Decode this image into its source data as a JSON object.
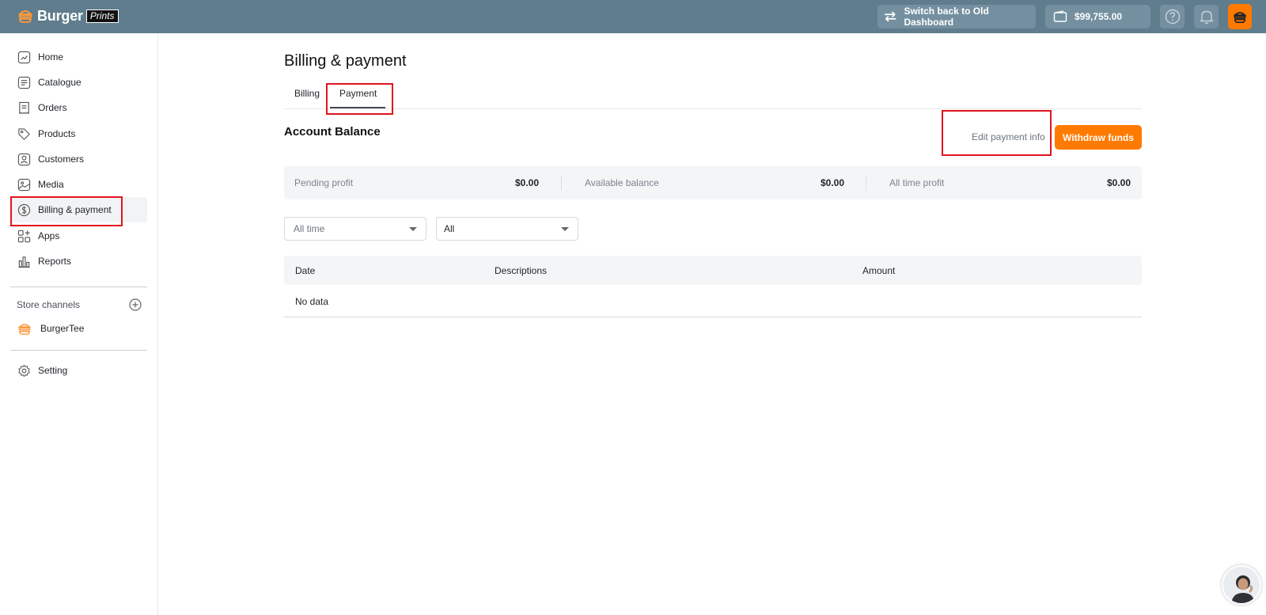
{
  "header": {
    "brand": "Burger",
    "brand_sub": "Prints",
    "switch_label": "Switch back to Old Dashboard",
    "balance": "$99,755.00",
    "accent_color": "#ff7a00",
    "bar_color": "#5f7d8c"
  },
  "sidebar": {
    "items": [
      {
        "label": "Home",
        "icon": "home-chart-icon"
      },
      {
        "label": "Catalogue",
        "icon": "catalogue-icon"
      },
      {
        "label": "Orders",
        "icon": "orders-icon"
      },
      {
        "label": "Products",
        "icon": "tag-icon"
      },
      {
        "label": "Customers",
        "icon": "customer-icon"
      },
      {
        "label": "Media",
        "icon": "image-icon"
      },
      {
        "label": "Billing & payment",
        "icon": "dollar-circle-icon"
      },
      {
        "label": "Apps",
        "icon": "apps-grid-icon"
      },
      {
        "label": "Reports",
        "icon": "bar-chart-icon"
      }
    ],
    "store_channels_label": "Store channels",
    "channel_name": "BurgerTee",
    "setting_label": "Setting"
  },
  "main": {
    "title": "Billing & payment",
    "tabs": [
      {
        "label": "Billing"
      },
      {
        "label": "Payment"
      }
    ],
    "account_balance_title": "Account Balance",
    "edit_payment_label": "Edit payment info",
    "withdraw_label": "Withdraw funds",
    "stats": [
      {
        "label": "Pending profit",
        "value": "$0.00"
      },
      {
        "label": "Available balance",
        "value": "$0.00"
      },
      {
        "label": "All time profit",
        "value": "$0.00"
      }
    ],
    "filters": {
      "time_value": "All time",
      "type_value": "All"
    },
    "table": {
      "columns": [
        "Date",
        "Descriptions",
        "Amount"
      ],
      "empty_text": "No data"
    }
  }
}
